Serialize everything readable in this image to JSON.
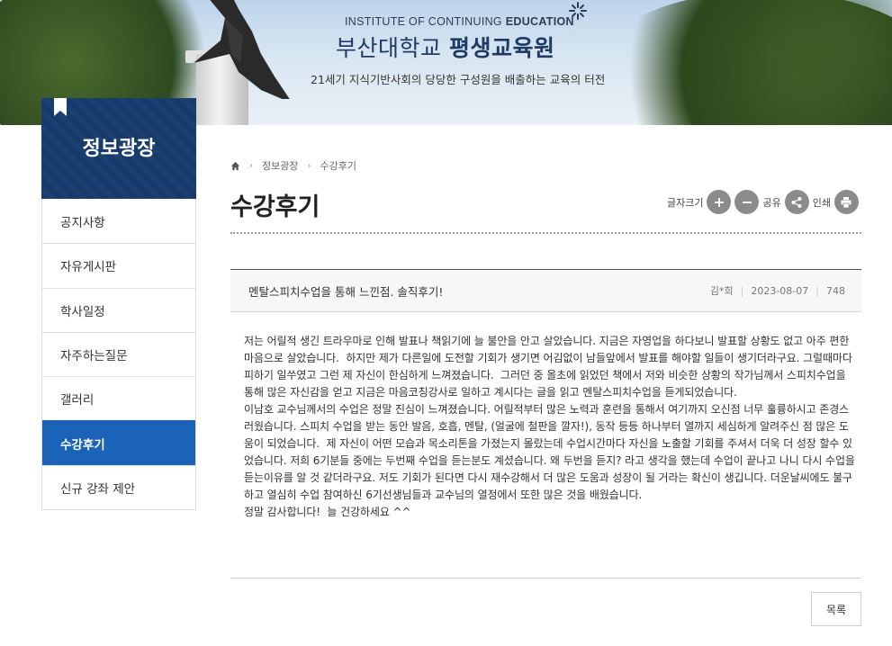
{
  "banner": {
    "subtitle_prefix": "INSTITUTE OF CONTINUING ",
    "subtitle_bold": "EDUCATION",
    "title_prefix": "부산대학교 ",
    "title_bold": "평생교육원",
    "slogan": "21세기 지식기반사회의 당당한 구성원을 배출하는 교육의 터전"
  },
  "sidebar": {
    "title": "정보광장",
    "items": [
      {
        "label": "공지사항",
        "active": false
      },
      {
        "label": "자유게시판",
        "active": false
      },
      {
        "label": "학사일정",
        "active": false
      },
      {
        "label": "자주하는질문",
        "active": false
      },
      {
        "label": "갤러리",
        "active": false
      },
      {
        "label": "수강후기",
        "active": true
      },
      {
        "label": "신규 강좌 제안",
        "active": false
      }
    ]
  },
  "breadcrumb": {
    "items": [
      "정보광장",
      "수강후기"
    ]
  },
  "page": {
    "title": "수강후기"
  },
  "tools": {
    "font_size_label": "글자크기",
    "share_label": "공유",
    "print_label": "인쇄"
  },
  "post": {
    "title": "멘탈스피치수업을 통해 느낀점. 솔직후기!",
    "author": "김*희",
    "date": "2023-08-07",
    "views": "748",
    "body": "저는 어릴적 생긴 트라우마로 인해 발표나 책읽기에 늘 불안을 안고 살았습니다. 지금은 자영업을 하다보니 발표할 상황도 없고 아주 편한마음으로 살았습니다.  하지만 제가 다른일에 도전할 기회가 생기면 어김없이 남들앞에서 발표를 해야할 일들이 생기더라구요. 그럴때마다 피하기 일쑤였고 그런 제 자신이 한심하게 느껴졌습니다.  그러던 중 올초에 읽었던 책에서 저와 비슷한 상황의 작가님께서 스피치수업을 통해 많은 자신감을 얻고 지금은 마음코칭강사로 일하고 계시다는 글을 읽고 멘탈스피치수업을 듣게되었습니다.\n이남호 교수님께서의 수업은 정말 진심이 느껴졌습니다. 어릴적부터 많은 노력과 훈련을 통해서 여기까지 오신점 너무 훌륭하시고 존경스러웠습니다. 스피치 수업을 받는 동안 발음, 호흡, 멘탈, (얼굴에 철판을 깔자!), 동작 등등 하나부터 열까지 세심하게 알려주신 점 많은 도움이 되었습니다.  제 자신이 어떤 모습과 목소리톤을 가졌는지 몰랐는데 수업시간마다 자신을 노출할 기회를 주셔서 더욱 더 성장 할수 있었습니다. 저희 6기분들 중에는 두번째 수업을 듣는분도 계셨습니다. 왜 두번을 듣지? 라고 생각을 했는데 수업이 끝나고 나니 다시 수업을 듣는이유를 알 것 같더라구요. 저도 기회가 된다면 다시 재수강해서 더 많은 도움과 성장이 될 거라는 확신이 생깁니다. 더운날씨에도 불구하고 열심히 수업 참여하신 6기선생님들과 교수님의 열정에서 또한 많은 것을 배웠습니다.\n정말 감사합니다!  늘 건강하세요 ^^"
  },
  "list_button": "목록",
  "colors": {
    "sidebar_head": "#173a6a",
    "sidebar_active": "#1a63b8",
    "tool_circle": "#8b8b8b",
    "title_blue": "#1f3a66"
  }
}
